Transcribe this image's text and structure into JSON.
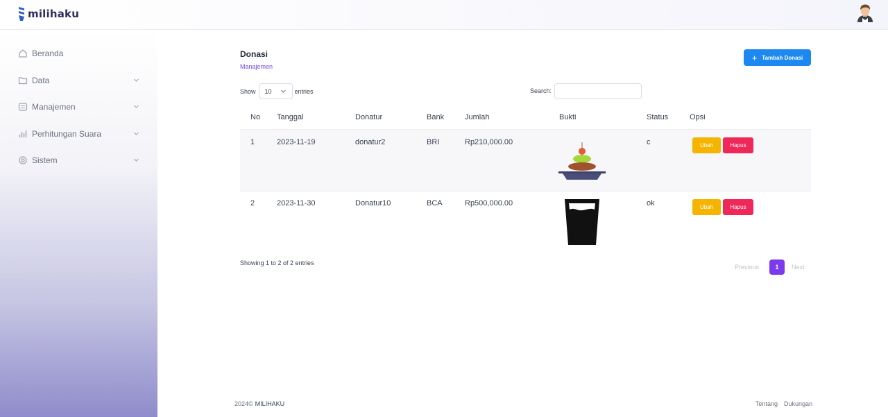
{
  "app": {
    "brand_name": "milihaku"
  },
  "sidebar": {
    "items": [
      {
        "label": "Beranda",
        "icon": "home-icon",
        "has_chevron": false
      },
      {
        "label": "Data",
        "icon": "folder-icon",
        "has_chevron": true
      },
      {
        "label": "Manajemen",
        "icon": "list-icon",
        "has_chevron": true
      },
      {
        "label": "Perhitungan Suara",
        "icon": "bar-chart-icon",
        "has_chevron": true
      },
      {
        "label": "Sistem",
        "icon": "gear-icon",
        "has_chevron": true
      }
    ]
  },
  "page": {
    "title": "Donasi",
    "breadcrumb": "Manajemen",
    "add_button_label": "Tambah Donasi"
  },
  "table_controls": {
    "show_label": "Show",
    "page_size": "10",
    "entries_label": "entries",
    "search_label": "Search:",
    "search_value": ""
  },
  "table": {
    "columns": [
      "No",
      "Tanggal",
      "Donatur",
      "Bank",
      "Jumlah",
      "Bukti",
      "Status",
      "Opsi"
    ],
    "rows": [
      {
        "no": "1",
        "tanggal": "2023-11-19",
        "donatur": "donatur2",
        "bank": "BRI",
        "jumlah": "Rp210,000.00",
        "bukti_icon": "food-plate-icon",
        "status": "c",
        "edit_label": "Ubah",
        "delete_label": "Hapus"
      },
      {
        "no": "2",
        "tanggal": "2023-11-30",
        "donatur": "Donatur10",
        "bank": "BCA",
        "jumlah": "Rp500,000.00",
        "bukti_icon": "drink-glass-icon",
        "status": "ok",
        "edit_label": "Ubah",
        "delete_label": "Hapus"
      }
    ]
  },
  "pagination": {
    "info": "Showing 1 to 2 of 2 entries",
    "previous": "Previous",
    "current": "1",
    "next": "Next"
  },
  "footer": {
    "year": "2024©",
    "brand": "MILIHAKU",
    "links": [
      "Tentang",
      "Dukungan"
    ]
  },
  "colors": {
    "primary_blue": "#1d89f0",
    "accent_purple": "#7c3aed",
    "edit_yellow": "#f4b400",
    "delete_red": "#f0285a"
  }
}
